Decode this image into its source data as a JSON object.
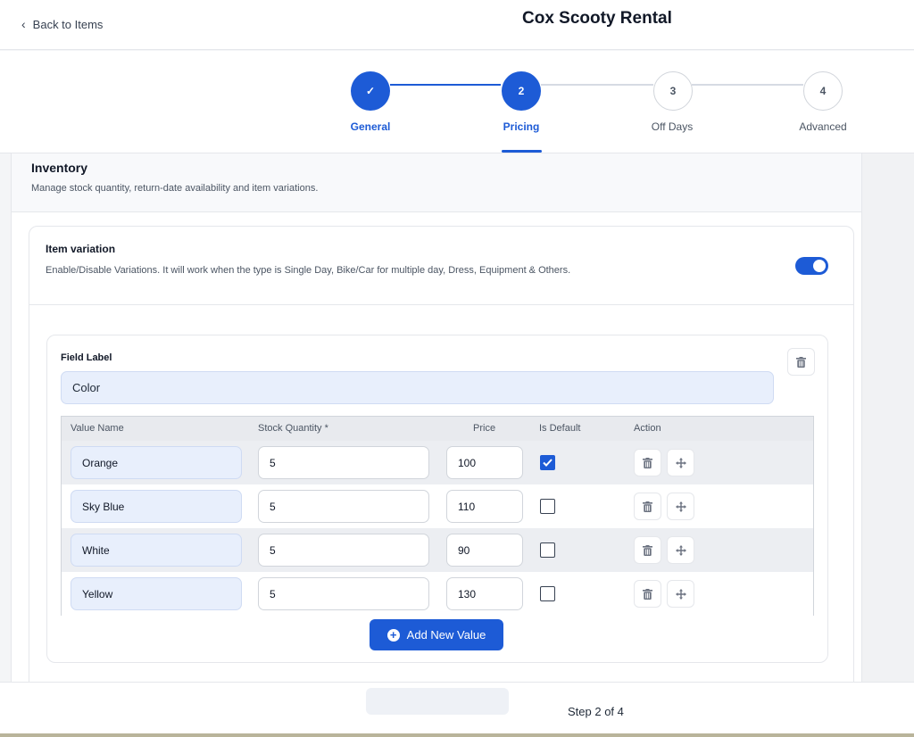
{
  "header": {
    "back_label": "Back to Items",
    "title": "Cox Scooty Rental"
  },
  "stepper": {
    "steps": [
      {
        "number": "✓",
        "label": "General",
        "state": "done"
      },
      {
        "number": "2",
        "label": "Pricing",
        "state": "active"
      },
      {
        "number": "3",
        "label": "Off Days",
        "state": "todo"
      },
      {
        "number": "4",
        "label": "Advanced",
        "state": "todo"
      }
    ]
  },
  "inventory": {
    "title": "Inventory",
    "subtitle": "Manage stock quantity, return-date availability and item variations."
  },
  "variation": {
    "title": "Item variation",
    "description": "Enable/Disable Variations. It will work when the type is Single Day, Bike/Car for multiple day, Dress, Equipment & Others.",
    "enabled": true,
    "field_label_title": "Field Label",
    "field_label_value": "Color",
    "columns": [
      "Value Name",
      "Stock Quantity *",
      "Price",
      "Is Default",
      "Action"
    ],
    "rows": [
      {
        "name": "Orange",
        "qty": "5",
        "price": "100",
        "is_default": true
      },
      {
        "name": "Sky Blue",
        "qty": "5",
        "price": "110",
        "is_default": false
      },
      {
        "name": "White",
        "qty": "5",
        "price": "90",
        "is_default": false
      },
      {
        "name": "Yellow",
        "qty": "5",
        "price": "130",
        "is_default": false
      }
    ],
    "add_button_label": "Add New Value"
  },
  "footer": {
    "step_text": "Step 2 of 4"
  },
  "colors": {
    "accent": "#1d5bd6",
    "input_fill": "#e8effc"
  }
}
